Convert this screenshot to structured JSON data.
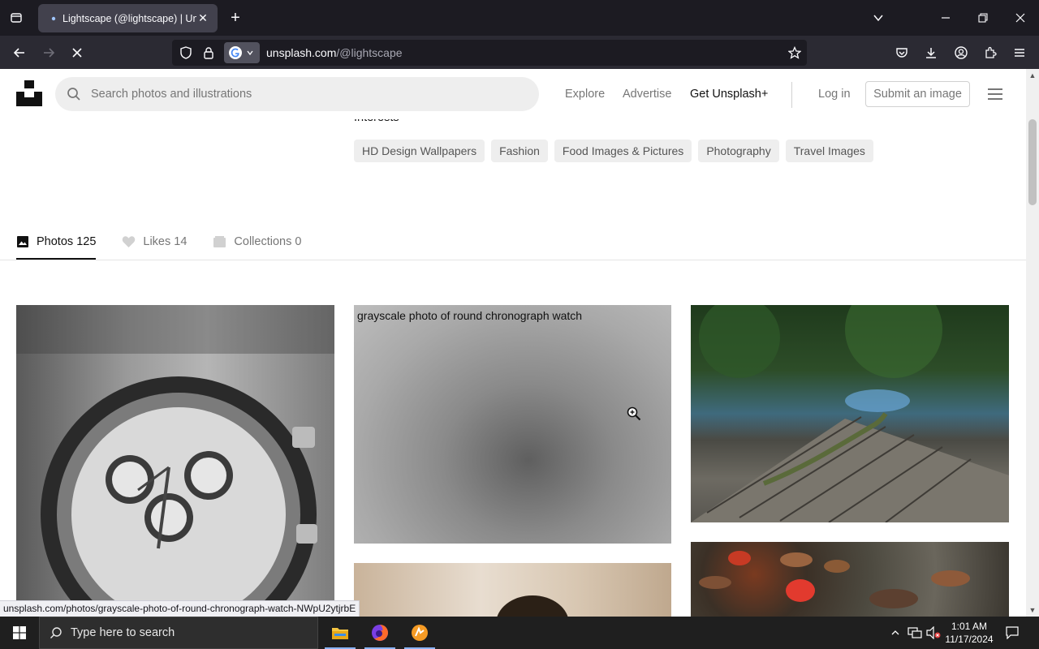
{
  "browser": {
    "tab_title": "Lightscape (@lightscape) | Unsplash",
    "new_tab": "+",
    "url_domain": "unsplash.com",
    "url_path": "/@lightscape"
  },
  "header": {
    "search_placeholder": "Search photos and illustrations",
    "explore": "Explore",
    "advertise": "Advertise",
    "get_plus": "Get Unsplash+",
    "login": "Log in",
    "submit": "Submit an image"
  },
  "profile": {
    "interests_label": "Interests",
    "tags": [
      "HD Design Wallpapers",
      "Fashion",
      "Food Images & Pictures",
      "Photography",
      "Travel Images"
    ],
    "tabs": [
      {
        "label": "Photos",
        "count": "125"
      },
      {
        "label": "Likes",
        "count": "14"
      },
      {
        "label": "Collections",
        "count": "0"
      }
    ]
  },
  "photos": {
    "hover_alt": "grayscale photo of round chronograph watch"
  },
  "status_url": "unsplash.com/photos/grayscale-photo-of-round-chronograph-watch-NWpU2ytjrbE",
  "taskbar": {
    "search_text": "Type here to search",
    "time": "1:01 AM",
    "date": "11/17/2024"
  },
  "colors": {
    "chrome_dark": "#1c1b22",
    "nav_bar": "#2b2a33",
    "tag_bg": "#eeeeee",
    "muted_text": "#767676"
  }
}
